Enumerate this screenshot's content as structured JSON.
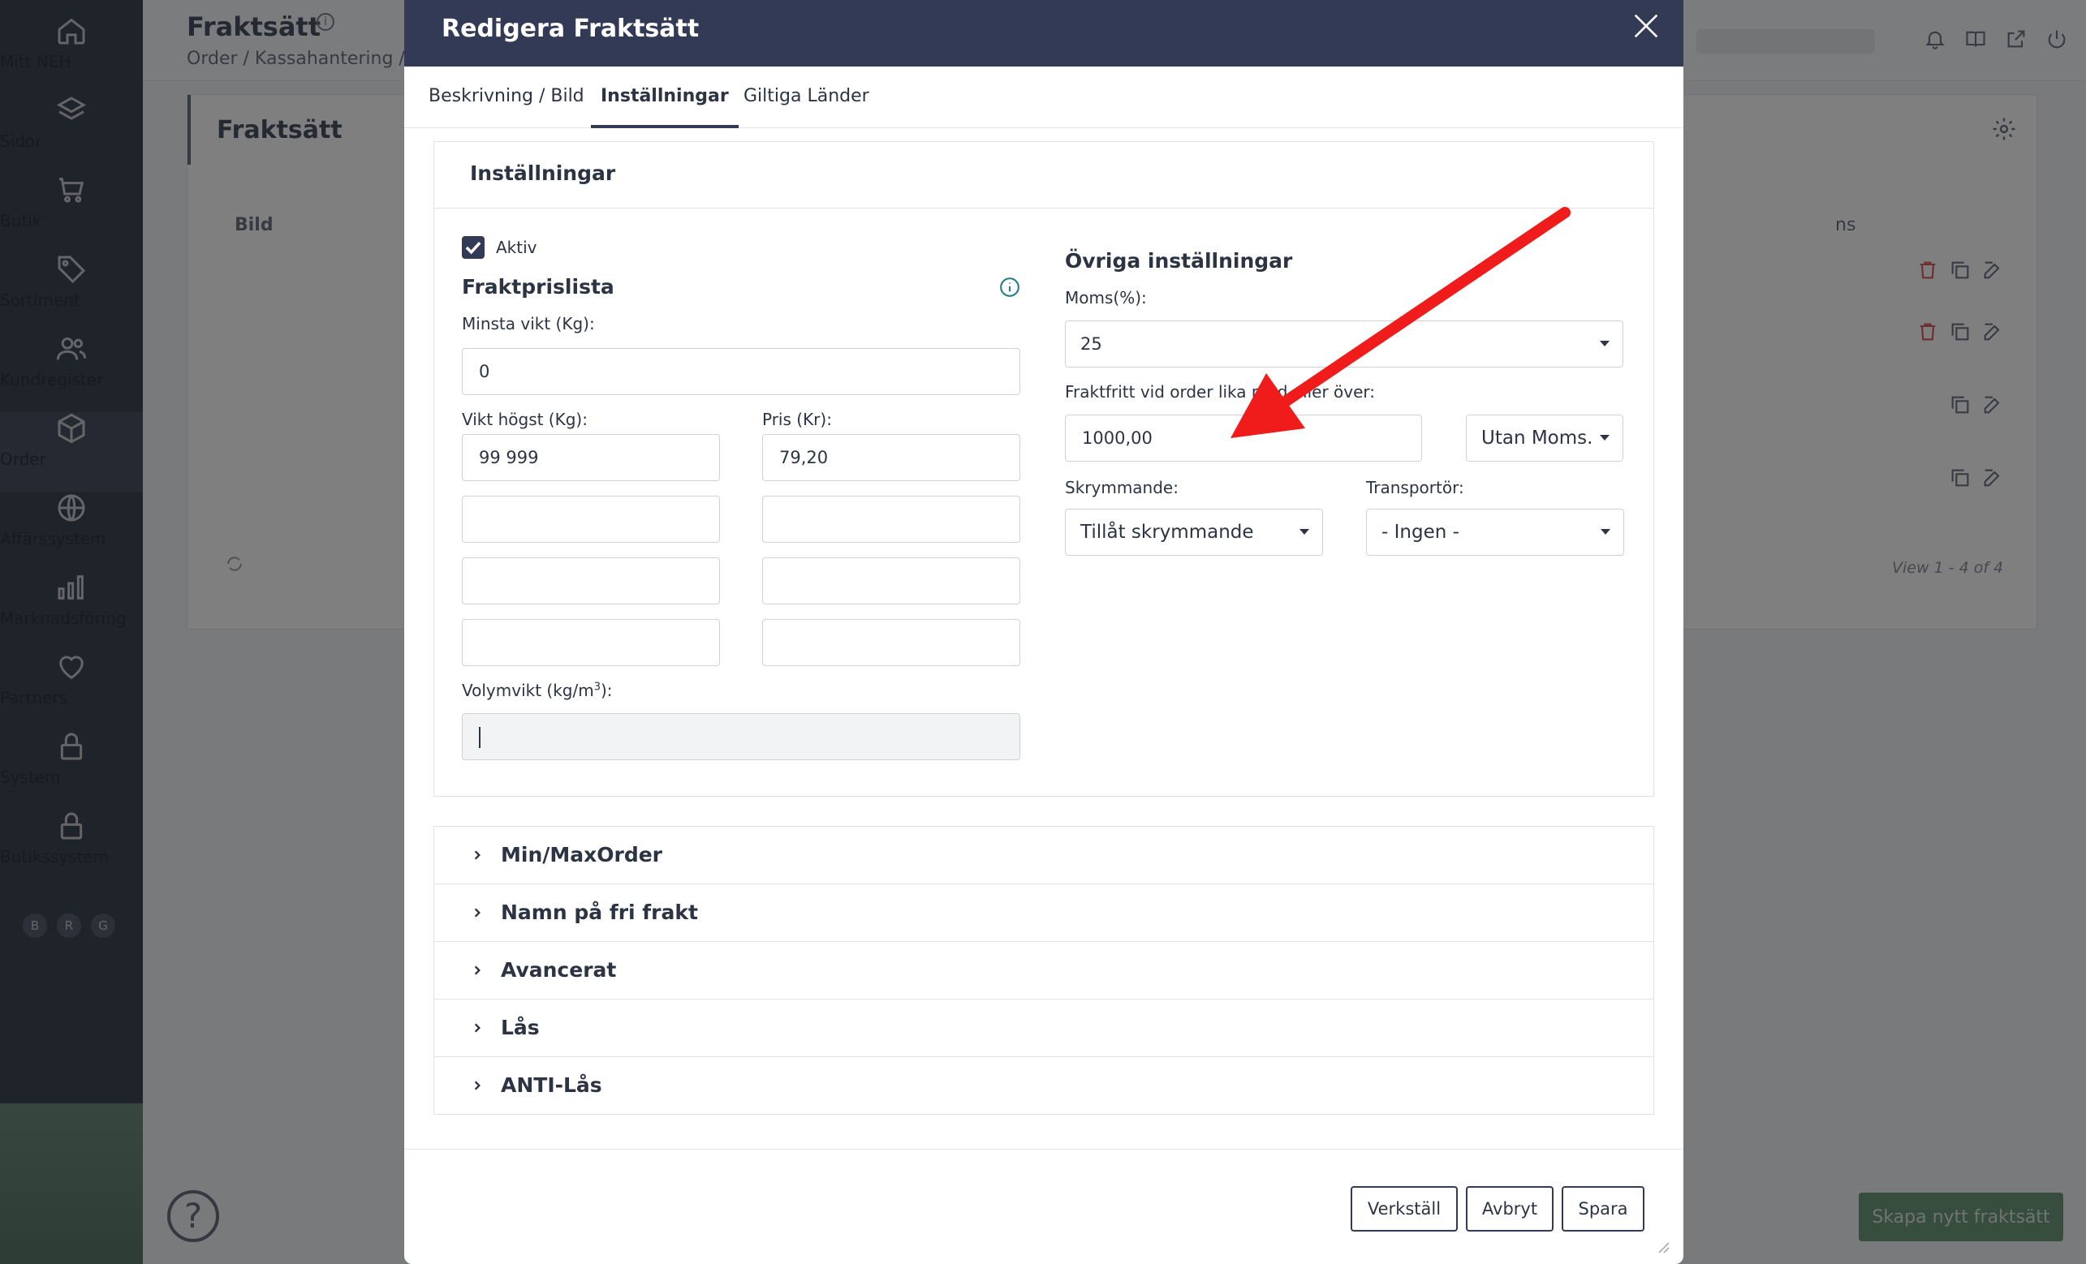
{
  "sidebar": {
    "items": [
      {
        "label": "Mitt NEH",
        "icon": "home-icon"
      },
      {
        "label": "Sidor",
        "icon": "layers-icon"
      },
      {
        "label": "Butik",
        "icon": "cart-icon"
      },
      {
        "label": "Sortiment",
        "icon": "tag-icon"
      },
      {
        "label": "Kundregister",
        "icon": "users-icon"
      },
      {
        "label": "Order",
        "icon": "box-icon"
      },
      {
        "label": "Affärssystem",
        "icon": "globe-icon"
      },
      {
        "label": "Marknadsföring",
        "icon": "bar-chart-icon"
      },
      {
        "label": "Partners",
        "icon": "heart-icon"
      },
      {
        "label": "System",
        "icon": "lock-icon"
      },
      {
        "label": "Butikssystem",
        "icon": "lock-icon"
      }
    ],
    "letters": [
      "B",
      "R",
      "G"
    ]
  },
  "background": {
    "title": "Fraktsätt",
    "breadcrumb": "Order / Kassahantering / F",
    "card_title": "Fraktsätt",
    "col_bild": "Bild",
    "col_ns": "ns",
    "view_count": "View 1 - 4 of 4",
    "create_button": "Skapa nytt fraktsätt"
  },
  "modal": {
    "title": "Redigera Fraktsätt",
    "tabs": [
      "Beskrivning / Bild",
      "Inställningar",
      "Giltiga Länder"
    ],
    "active_tab": "Inställningar",
    "panel_title": "Inställningar",
    "left": {
      "aktiv_label": "Aktiv",
      "aktiv_checked": true,
      "fraktprislista_title": "Fraktprislista",
      "minsta_vikt_label": "Minsta vikt (Kg):",
      "minsta_vikt_value": "0",
      "vikt_hogst_label": "Vikt högst (Kg):",
      "pris_label": "Pris (Kr):",
      "price_rows": [
        {
          "vikt": "99 999",
          "pris": "79,20"
        },
        {
          "vikt": "",
          "pris": ""
        },
        {
          "vikt": "",
          "pris": ""
        },
        {
          "vikt": "",
          "pris": ""
        }
      ],
      "volymvikt_label": "Volymvikt (kg/m",
      "volymvikt_sup": "3",
      "volymvikt_suffix": "):",
      "volymvikt_value": ""
    },
    "right": {
      "title": "Övriga inställningar",
      "moms_label": "Moms(%):",
      "moms_value": "25",
      "fraktfritt_label": "Fraktfritt vid order lika med eller över:",
      "fraktfritt_value": "1000,00",
      "fraktfritt_moms_option": "Utan Moms.",
      "skrymmande_label": "Skrymmande:",
      "skrymmande_value": "Tillåt skrymmande",
      "transportor_label": "Transportör:",
      "transportor_value": "- Ingen -"
    },
    "accordions": [
      "Min/MaxOrder",
      "Namn på fri frakt",
      "Avancerat",
      "Lås",
      "ANTI-Lås"
    ],
    "buttons": {
      "apply": "Verkställ",
      "cancel": "Avbryt",
      "save": "Spara"
    }
  },
  "colors": {
    "modal_header": "#333a55",
    "sidebar": "#3e4654",
    "arrow": "#f01c1c",
    "create_button": "#6f9a7d"
  }
}
